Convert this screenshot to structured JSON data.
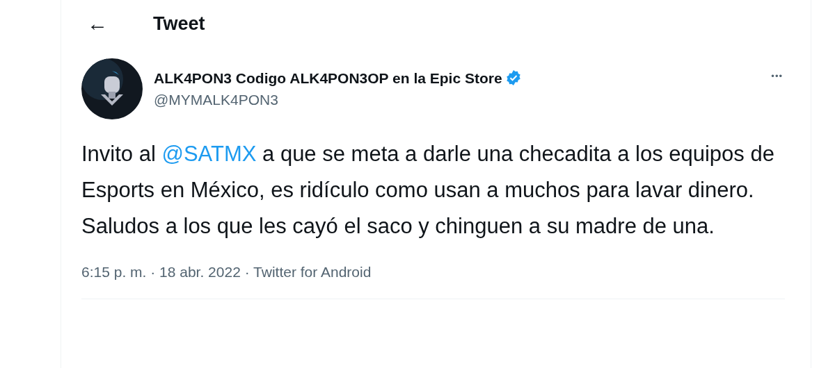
{
  "header": {
    "back": "←",
    "title": "Tweet"
  },
  "tweet": {
    "author": {
      "name": "ALK4PON3 Codigo ALK4PON3OP en la Epic Store",
      "verified": true,
      "handle": "@MYMALK4PON3"
    },
    "more": "•••",
    "body": [
      {
        "kind": "text",
        "text": "Invito al "
      },
      {
        "kind": "mention",
        "text": "@SATMX"
      },
      {
        "kind": "text",
        "text": " a que se meta a darle una checadita a los equipos de Esports en México, es ridículo como usan a muchos para lavar dinero. Saludos a los que les cayó el saco y chinguen a su madre de una."
      }
    ],
    "meta": "6:15 p. m. · 18 abr. 2022 · Twitter for Android"
  }
}
